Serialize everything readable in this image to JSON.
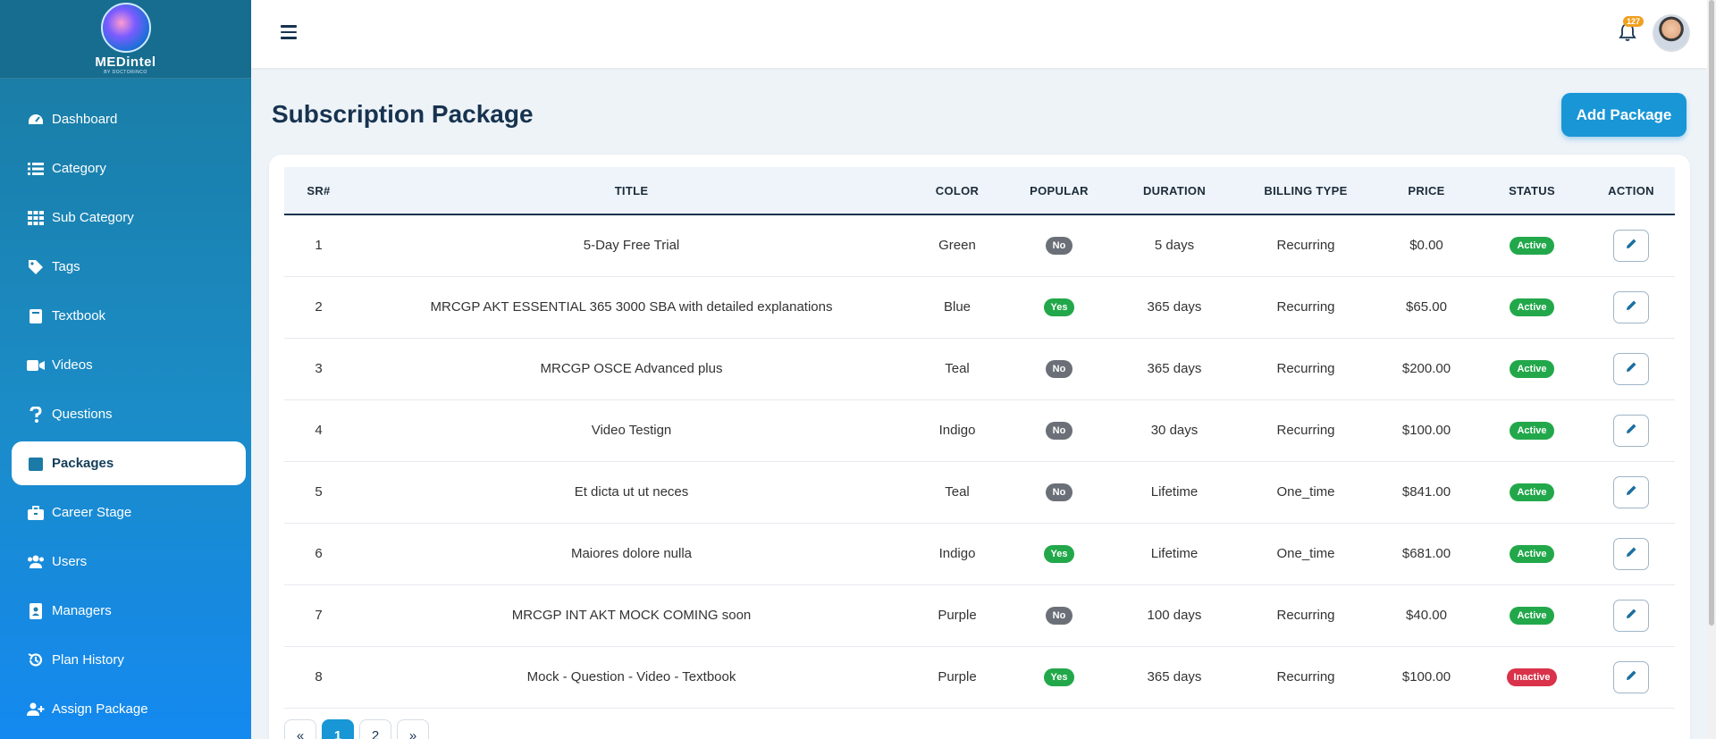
{
  "app": {
    "logo_text": "MEDintel",
    "logo_subtext": "BY DOCTORINCO"
  },
  "sidebar": {
    "items": [
      {
        "label": "Dashboard",
        "icon": "dashboard-icon"
      },
      {
        "label": "Category",
        "icon": "list-icon"
      },
      {
        "label": "Sub Category",
        "icon": "grid-icon"
      },
      {
        "label": "Tags",
        "icon": "tag-icon"
      },
      {
        "label": "Textbook",
        "icon": "book-icon"
      },
      {
        "label": "Videos",
        "icon": "video-icon"
      },
      {
        "label": "Questions",
        "icon": "question-icon"
      },
      {
        "label": "Packages",
        "icon": "box-icon",
        "active": true
      },
      {
        "label": "Career Stage",
        "icon": "briefcase-icon"
      },
      {
        "label": "Users",
        "icon": "users-icon"
      },
      {
        "label": "Managers",
        "icon": "id-badge-icon"
      },
      {
        "label": "Plan History",
        "icon": "history-icon"
      },
      {
        "label": "Assign Package",
        "icon": "user-plus-icon"
      }
    ]
  },
  "header": {
    "notification_count": "127"
  },
  "main": {
    "title": "Subscription Package",
    "add_button": "Add Package"
  },
  "table": {
    "columns": [
      "SR#",
      "TITLE",
      "COLOR",
      "POPULAR",
      "DURATION",
      "BILLING TYPE",
      "PRICE",
      "STATUS",
      "ACTION"
    ],
    "rows": [
      {
        "sr": "1",
        "title": "5-Day Free Trial",
        "color": "Green",
        "popular": "No",
        "duration": "5 days",
        "billing": "Recurring",
        "price": "$0.00",
        "status": "Active"
      },
      {
        "sr": "2",
        "title": "MRCGP AKT ESSENTIAL 365 3000 SBA with detailed explanations",
        "color": "Blue",
        "popular": "Yes",
        "duration": "365 days",
        "billing": "Recurring",
        "price": "$65.00",
        "status": "Active"
      },
      {
        "sr": "3",
        "title": "MRCGP OSCE Advanced plus",
        "color": "Teal",
        "popular": "No",
        "duration": "365 days",
        "billing": "Recurring",
        "price": "$200.00",
        "status": "Active"
      },
      {
        "sr": "4",
        "title": "Video Testign",
        "color": "Indigo",
        "popular": "No",
        "duration": "30 days",
        "billing": "Recurring",
        "price": "$100.00",
        "status": "Active"
      },
      {
        "sr": "5",
        "title": "Et dicta ut ut neces",
        "color": "Teal",
        "popular": "No",
        "duration": "Lifetime",
        "billing": "One_time",
        "price": "$841.00",
        "status": "Active"
      },
      {
        "sr": "6",
        "title": "Maiores dolore nulla",
        "color": "Indigo",
        "popular": "Yes",
        "duration": "Lifetime",
        "billing": "One_time",
        "price": "$681.00",
        "status": "Active"
      },
      {
        "sr": "7",
        "title": "MRCGP INT AKT MOCK COMING soon",
        "color": "Purple",
        "popular": "No",
        "duration": "100 days",
        "billing": "Recurring",
        "price": "$40.00",
        "status": "Active"
      },
      {
        "sr": "8",
        "title": "Mock - Question - Video - Textbook",
        "color": "Purple",
        "popular": "Yes",
        "duration": "365 days",
        "billing": "Recurring",
        "price": "$100.00",
        "status": "Inactive"
      }
    ]
  },
  "pagination": {
    "prev": "«",
    "pages": [
      "1",
      "2"
    ],
    "current": "1",
    "next": "»"
  },
  "colors": {
    "accent": "#1996d6",
    "sidebar_top": "#1a7a9f",
    "sidebar_bottom": "#1489f0",
    "title": "#17334f",
    "status_active": "#22a84a",
    "status_inactive": "#d9324a",
    "popular_no": "#6b7078"
  }
}
